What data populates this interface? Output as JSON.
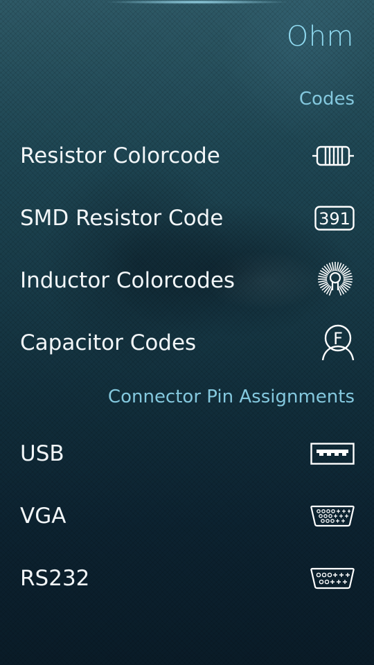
{
  "app": {
    "title": "Ohm"
  },
  "sections": [
    {
      "header": "Codes",
      "items": [
        {
          "label": "Resistor Colorcode",
          "icon": "resistor-icon"
        },
        {
          "label": "SMD Resistor Code",
          "icon": "smd-code-icon",
          "icon_text": "391"
        },
        {
          "label": "Inductor Colorcodes",
          "icon": "inductor-coil-icon"
        },
        {
          "label": "Capacitor Codes",
          "icon": "capacitor-farad-icon",
          "icon_text": "F"
        }
      ]
    },
    {
      "header": "Connector Pin Assignments",
      "items": [
        {
          "label": "USB",
          "icon": "usb-port-icon"
        },
        {
          "label": "VGA",
          "icon": "vga-connector-icon"
        },
        {
          "label": "RS232",
          "icon": "rs232-connector-icon"
        }
      ]
    }
  ],
  "colors": {
    "title": "#8fd9ef",
    "section_header": "#84c8de",
    "item_text": "#f2f6f8",
    "background_top": "#2e5966",
    "background_bottom": "#0a1c28"
  }
}
